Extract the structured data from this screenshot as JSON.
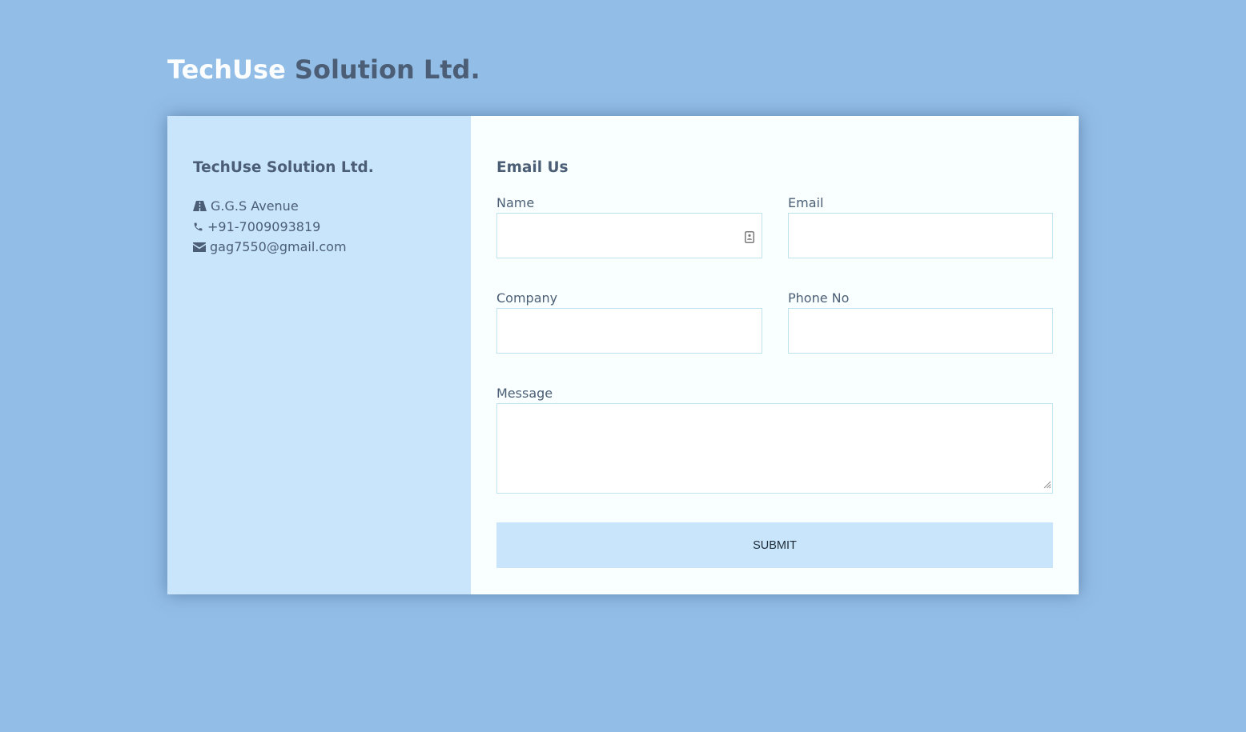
{
  "header": {
    "brand_first": "TechUse",
    "brand_second": "Solution Ltd."
  },
  "contact_info": {
    "title": "TechUse Solution Ltd.",
    "items": [
      {
        "icon": "road-icon",
        "text": "G.G.S Avenue"
      },
      {
        "icon": "phone-icon",
        "text": "+91-7009093819"
      },
      {
        "icon": "envelope-icon",
        "text": "gag7550@gmail.com"
      }
    ]
  },
  "form": {
    "title": "Email Us",
    "fields": {
      "name": {
        "label": "Name",
        "value": ""
      },
      "email": {
        "label": "Email",
        "value": ""
      },
      "company": {
        "label": "Company",
        "value": ""
      },
      "phone": {
        "label": "Phone No",
        "value": ""
      },
      "message": {
        "label": "Message",
        "value": ""
      }
    },
    "submit_label": "SUBMIT"
  },
  "colors": {
    "page_background": "#92bde6",
    "panel_light_blue": "#c8e5fb",
    "form_background": "#f8fffe",
    "text_slate": "#4b5e75",
    "brand_white": "#fbfdff",
    "input_border": "#bfe3ee"
  }
}
